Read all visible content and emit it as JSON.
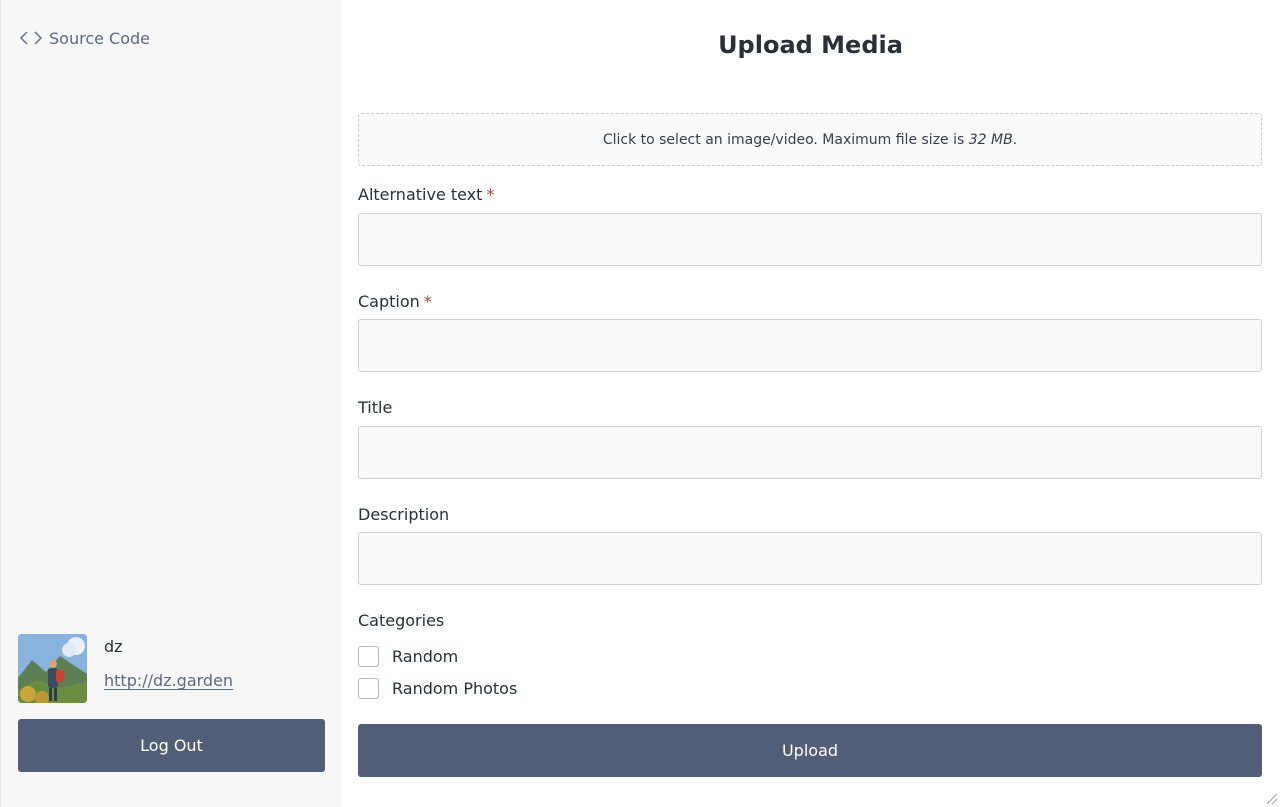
{
  "sidebar": {
    "source_link": {
      "icon": "code-brackets-icon",
      "label": "Source Code"
    },
    "user": {
      "avatar": "user-avatar-photo",
      "name": "dz",
      "url": "http://dz.garden"
    },
    "logout_label": "Log Out"
  },
  "main": {
    "title": "Upload Media",
    "dropzone": {
      "text": "Click to select an image/video. Maximum file size is ",
      "size": "32 MB",
      "suffix": "."
    },
    "fields": {
      "alt_text": {
        "label": "Alternative text",
        "required_marker": "*",
        "value": ""
      },
      "caption": {
        "label": "Caption",
        "required_marker": "*",
        "value": ""
      },
      "title": {
        "label": "Title",
        "value": ""
      },
      "description": {
        "label": "Description",
        "value": ""
      }
    },
    "categories": {
      "label": "Categories",
      "options": [
        {
          "label": "Random",
          "checked": false
        },
        {
          "label": "Random Photos",
          "checked": false
        }
      ]
    },
    "upload_label": "Upload"
  },
  "colors": {
    "button_bg": "#525e78",
    "required": "#b5403a",
    "link": "#5f6b7f"
  }
}
